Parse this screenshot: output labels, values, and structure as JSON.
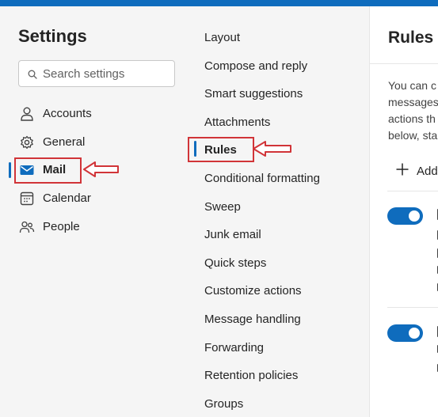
{
  "settings": {
    "title": "Settings",
    "search_placeholder": "Search settings"
  },
  "sidebar": {
    "items": [
      {
        "label": "Accounts",
        "icon": "person-icon"
      },
      {
        "label": "General",
        "icon": "gear-icon"
      },
      {
        "label": "Mail",
        "icon": "mail-icon",
        "active": true
      },
      {
        "label": "Calendar",
        "icon": "calendar-icon"
      },
      {
        "label": "People",
        "icon": "people-icon"
      }
    ]
  },
  "mail_settings": {
    "items": [
      {
        "label": "Layout"
      },
      {
        "label": "Compose and reply"
      },
      {
        "label": "Smart suggestions"
      },
      {
        "label": "Attachments"
      },
      {
        "label": "Rules",
        "active": true
      },
      {
        "label": "Conditional formatting"
      },
      {
        "label": "Sweep"
      },
      {
        "label": "Junk email"
      },
      {
        "label": "Quick steps"
      },
      {
        "label": "Customize actions"
      },
      {
        "label": "Message handling"
      },
      {
        "label": "Forwarding"
      },
      {
        "label": "Retention policies"
      },
      {
        "label": "Groups"
      }
    ]
  },
  "rules_pane": {
    "title": "Rules",
    "description_lines": [
      "You can c",
      "messages",
      "actions th",
      "below, sta"
    ],
    "add_rule_label": "Add",
    "toggles": [
      {
        "on": true
      },
      {
        "on": true
      }
    ]
  },
  "colors": {
    "accent": "#0f6cbd",
    "annotation": "#d13438",
    "panel_bg": "#f5f5f5"
  }
}
